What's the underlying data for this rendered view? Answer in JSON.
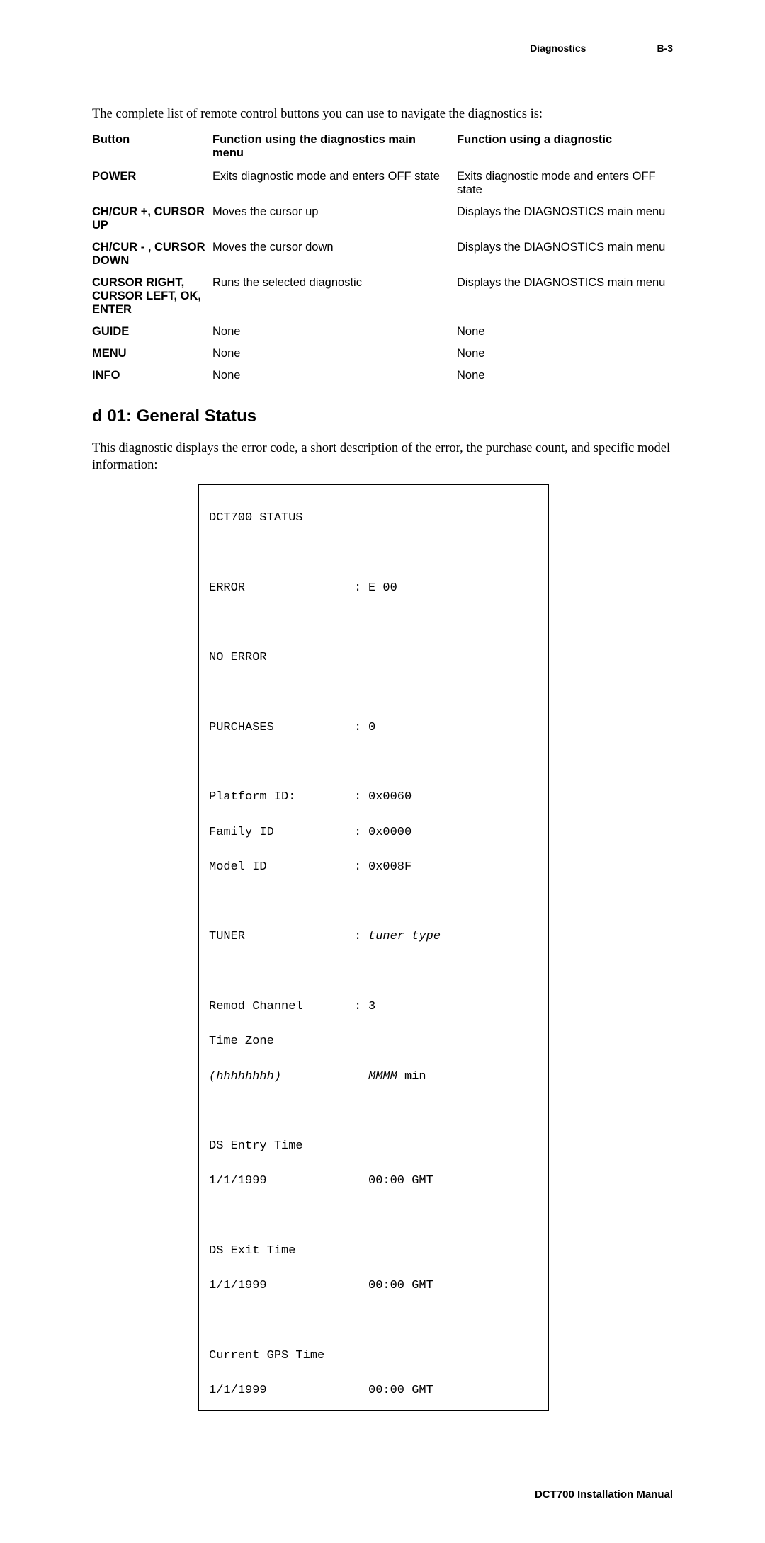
{
  "header": {
    "section": "Diagnostics",
    "page": "B-3"
  },
  "intro": "The complete list of remote control buttons you can use to navigate the diagnostics is:",
  "table": {
    "head": {
      "c1": "Button",
      "c2": "Function using the diagnostics main menu",
      "c3": "Function using a diagnostic"
    },
    "rows": [
      {
        "c1": "POWER",
        "c2": "Exits diagnostic mode and enters OFF state",
        "c3": "Exits diagnostic mode and enters OFF state"
      },
      {
        "c1": "CH/CUR +, CURSOR UP",
        "c2": "Moves the cursor up",
        "c3": "Displays the DIAGNOSTICS main menu"
      },
      {
        "c1": "CH/CUR - , CURSOR DOWN",
        "c2": "Moves the cursor down",
        "c3": "Displays the DIAGNOSTICS main menu"
      },
      {
        "c1": "CURSOR RIGHT, CURSOR LEFT, OK, ENTER",
        "c2": "Runs the selected diagnostic",
        "c3": "Displays the DIAGNOSTICS main menu"
      },
      {
        "c1": "GUIDE",
        "c2": "None",
        "c3": "None"
      },
      {
        "c1": "MENU",
        "c2": "None",
        "c3": "None"
      },
      {
        "c1": "INFO",
        "c2": "None",
        "c3": "None"
      }
    ]
  },
  "section": {
    "title": "d 01: General Status",
    "desc": "This diagnostic displays the error code, a short description of the error, the purchase count, and specific model information:"
  },
  "status": {
    "title": "DCT700 STATUS",
    "error_lbl": "ERROR",
    "error_val": "E 00",
    "noerr": "NO ERROR",
    "purch_lbl": "PURCHASES",
    "purch_val": "0",
    "plat_lbl": "Platform ID:",
    "plat_val": "0x0060",
    "fam_lbl": "Family ID",
    "fam_val": "0x0000",
    "mod_lbl": "Model ID",
    "mod_val": "0x008F",
    "tun_lbl": "TUNER",
    "tun_val": "tuner type",
    "rem_lbl": "Remod Channel",
    "rem_val": "3",
    "tz_lbl": "Time Zone",
    "tz_hh": "(hhhhhhhh)",
    "tz_val": "MMMM",
    "tz_min": " min",
    "dse_lbl": "DS Entry Time",
    "dse_date": "1/1/1999",
    "dse_time": "00:00 GMT",
    "dsx_lbl": "DS Exit Time",
    "dsx_date": "1/1/1999",
    "dsx_time": "00:00 GMT",
    "gps_lbl": "Current GPS Time",
    "gps_date": "1/1/1999",
    "gps_time": "00:00 GMT"
  },
  "footer": "DCT700 Installation Manual"
}
